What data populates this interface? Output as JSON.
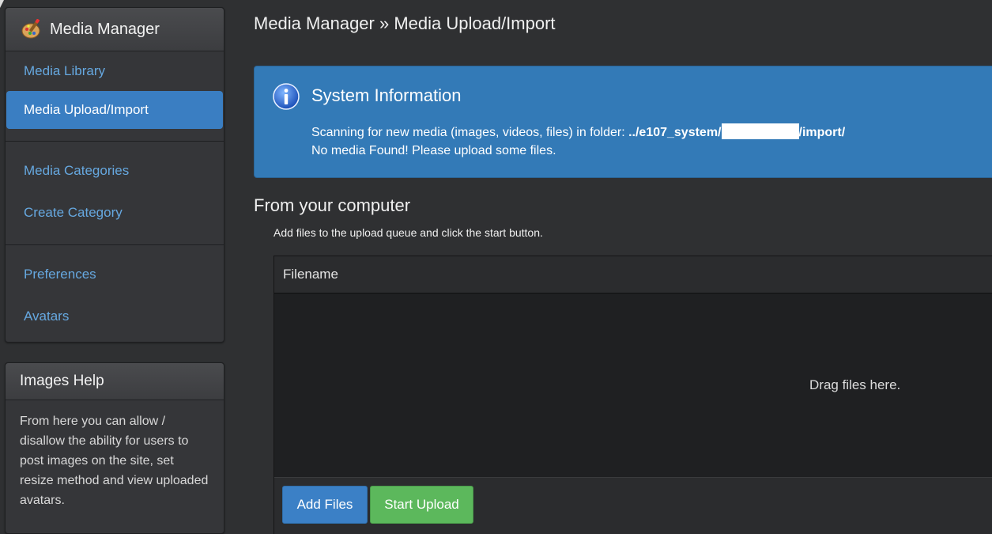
{
  "sidebar": {
    "title": "Media Manager",
    "items": [
      {
        "label": "Media Library"
      },
      {
        "label": "Media Upload/Import"
      },
      {
        "label": "Media Categories"
      },
      {
        "label": "Create Category"
      },
      {
        "label": "Preferences"
      },
      {
        "label": "Avatars"
      }
    ],
    "active_index": 1
  },
  "help": {
    "title": "Images Help",
    "body": "From here you can allow / disallow the ability for users to post images on the site, set resize method and view uploaded avatars."
  },
  "main": {
    "title": "Media Manager » Media Upload/Import",
    "alert": {
      "title": "System Information",
      "scan_prefix": "Scanning for new media (images, videos, files) in folder: ",
      "path_start": "../e107_system/",
      "path_end": "/import/",
      "no_media": "No media Found! Please upload some files."
    },
    "section_title": "From your computer",
    "section_subtitle": "Add files to the upload queue and click the start button.",
    "uploader": {
      "column_header": "Filename",
      "drop_text": "Drag files here.",
      "add_label": "Add Files",
      "start_label": "Start Upload"
    }
  },
  "colors": {
    "accent": "#337ab7",
    "link": "#66a8e0",
    "success": "#5cb85c",
    "background": "#2f3032"
  },
  "icons": [
    "media-manager-logo-icon",
    "info-icon"
  ]
}
